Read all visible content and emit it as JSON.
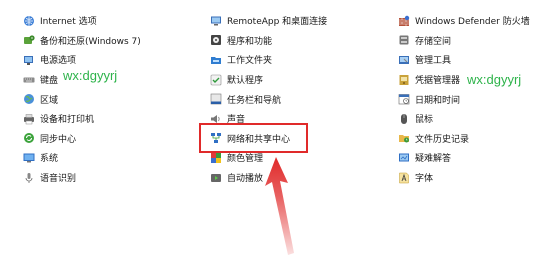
{
  "columns": [
    {
      "items": [
        {
          "label": "Internet 选项",
          "icon": "internet-options-icon"
        },
        {
          "label": "备份和还原(Windows 7)",
          "icon": "backup-restore-icon"
        },
        {
          "label": "电源选项",
          "icon": "power-options-icon"
        },
        {
          "label": "键盘",
          "icon": "keyboard-icon"
        },
        {
          "label": "区域",
          "icon": "region-icon"
        },
        {
          "label": "设备和打印机",
          "icon": "devices-printers-icon"
        },
        {
          "label": "同步中心",
          "icon": "sync-center-icon"
        },
        {
          "label": "系统",
          "icon": "system-icon"
        },
        {
          "label": "语音识别",
          "icon": "speech-recognition-icon"
        }
      ]
    },
    {
      "items": [
        {
          "label": "RemoteApp 和桌面连接",
          "icon": "remoteapp-icon"
        },
        {
          "label": "程序和功能",
          "icon": "programs-features-icon"
        },
        {
          "label": "工作文件夹",
          "icon": "work-folders-icon"
        },
        {
          "label": "默认程序",
          "icon": "default-programs-icon"
        },
        {
          "label": "任务栏和导航",
          "icon": "taskbar-navigation-icon"
        },
        {
          "label": "声音",
          "icon": "sound-icon"
        },
        {
          "label": "网络和共享中心",
          "icon": "network-sharing-icon"
        },
        {
          "label": "颜色管理",
          "icon": "color-management-icon"
        },
        {
          "label": "自动播放",
          "icon": "autoplay-icon"
        }
      ]
    },
    {
      "items": [
        {
          "label": "Windows Defender 防火墙",
          "icon": "firewall-icon"
        },
        {
          "label": "存储空间",
          "icon": "storage-spaces-icon"
        },
        {
          "label": "管理工具",
          "icon": "admin-tools-icon"
        },
        {
          "label": "凭据管理器",
          "icon": "credential-manager-icon"
        },
        {
          "label": "日期和时间",
          "icon": "date-time-icon"
        },
        {
          "label": "鼠标",
          "icon": "mouse-icon"
        },
        {
          "label": "文件历史记录",
          "icon": "file-history-icon"
        },
        {
          "label": "疑难解答",
          "icon": "troubleshooting-icon"
        },
        {
          "label": "字体",
          "icon": "fonts-icon"
        }
      ]
    }
  ],
  "watermarks": [
    "wx:dgyyrj",
    "wx:dgyyrj"
  ],
  "colors": {
    "highlight": "#e02a2a",
    "watermark": "#2db34a"
  }
}
